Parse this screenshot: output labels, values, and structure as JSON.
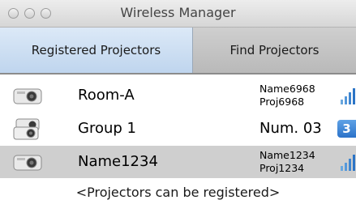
{
  "window": {
    "title": "Wireless Manager"
  },
  "tabs": [
    {
      "label": "Registered Projectors",
      "active": true
    },
    {
      "label": "Find Projectors",
      "active": false
    }
  ],
  "rows": [
    {
      "name": "Room-A",
      "line1": "Name6968",
      "line2": "Proj6968",
      "icon": "projector-icon",
      "indicator": "signal-strength-icon",
      "selected": false
    },
    {
      "name": "Group 1",
      "number": "Num. 03",
      "badge": "3",
      "icon": "projector-group-icon",
      "selected": false
    },
    {
      "name": "Name1234",
      "line1": "Name1234",
      "line2": "Proj1234",
      "icon": "projector-icon",
      "indicator": "signal-strength-icon",
      "selected": true
    }
  ],
  "footer_hint": "<Projectors can be registered>",
  "colors": {
    "tab_active": "#c9dcf1",
    "selected_row": "#cfcfcf",
    "badge": "#3b82d4",
    "signal": "#4a8fd6"
  }
}
